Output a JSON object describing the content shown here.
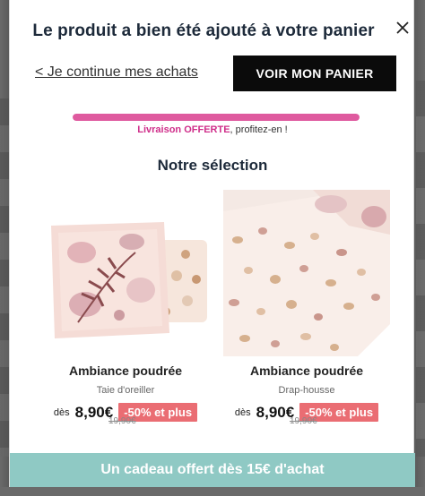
{
  "modal": {
    "title": "Le produit a bien été ajouté à votre panier",
    "close_icon": "close-icon",
    "continue_link": "< Je continue mes achats",
    "cart_button": "VOIR MON PANIER"
  },
  "shipping": {
    "progress": 1.0,
    "highlight": "Livraison OFFERTE",
    "rest": ", profitez-en !"
  },
  "selection": {
    "title": "Notre sélection",
    "products": [
      {
        "name": "Ambiance poudrée",
        "subtitle": "Taie d'oreiller",
        "from_label": "dès",
        "price": "8,90€",
        "badge": "-50% et plus",
        "old_price": "19,90€"
      },
      {
        "name": "Ambiance poudrée",
        "subtitle": "Drap-housse",
        "from_label": "dès",
        "price": "8,90€",
        "badge": "-50% et plus",
        "old_price": "19,90€"
      }
    ]
  },
  "gift": {
    "label": "Un cadeau offert dès 15€ d'achat"
  },
  "colors": {
    "progress": "#df5a9f",
    "badge": "#ea6d73",
    "gift_bar": "#8fc9c4",
    "cart_button": "#0b0b0b"
  }
}
